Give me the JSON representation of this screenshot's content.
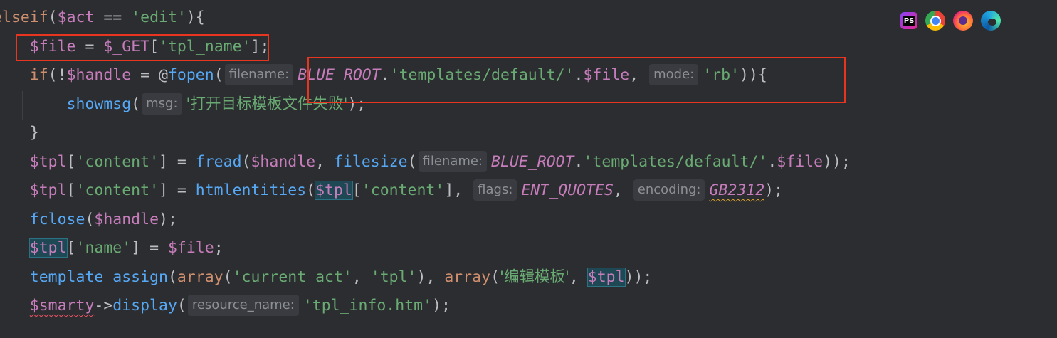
{
  "code_lines": [
    {
      "tokens": [
        {
          "t": "elseif",
          "c": "kw"
        },
        {
          "t": "(",
          "c": "op"
        },
        {
          "t": "$act",
          "c": "var"
        },
        {
          "t": " == ",
          "c": "op"
        },
        {
          "t": "'edit'",
          "c": "str"
        },
        {
          "t": "){",
          "c": "op"
        }
      ]
    },
    {
      "tokens": [
        {
          "t": "    ",
          "c": "op"
        },
        {
          "t": "$file",
          "c": "var"
        },
        {
          "t": " = ",
          "c": "op"
        },
        {
          "t": "$_GET",
          "c": "var"
        },
        {
          "t": "[",
          "c": "op"
        },
        {
          "t": "'tpl_name'",
          "c": "str"
        },
        {
          "t": "];",
          "c": "op"
        }
      ]
    },
    {
      "tokens": [
        {
          "t": "    ",
          "c": "op"
        },
        {
          "t": "if",
          "c": "kw"
        },
        {
          "t": "(!",
          "c": "op"
        },
        {
          "t": "$handle",
          "c": "var"
        },
        {
          "t": " = ",
          "c": "op"
        },
        {
          "t": "@",
          "c": "op"
        },
        {
          "t": "fopen",
          "c": "fn"
        },
        {
          "t": "(",
          "c": "op"
        },
        {
          "hint": "filename:"
        },
        {
          "t": "BLUE_ROOT",
          "c": "const"
        },
        {
          "t": ".",
          "c": "op"
        },
        {
          "t": "'templates/default/'",
          "c": "str"
        },
        {
          "t": ".",
          "c": "op"
        },
        {
          "t": "$file",
          "c": "var"
        },
        {
          "t": ", ",
          "c": "op"
        },
        {
          "hint": "mode:"
        },
        {
          "t": "'rb'",
          "c": "str"
        },
        {
          "t": ")){",
          "c": "op"
        }
      ]
    },
    {
      "tokens": [
        {
          "t": "        ",
          "c": "op"
        },
        {
          "t": "showmsg",
          "c": "fn"
        },
        {
          "t": "(",
          "c": "op"
        },
        {
          "hint": "msg:"
        },
        {
          "t": "'打开目标模板文件失败'",
          "c": "str cjk"
        },
        {
          "t": ");",
          "c": "op"
        }
      ]
    },
    {
      "tokens": [
        {
          "t": "    ",
          "c": "op"
        },
        {
          "t": "}",
          "c": "op"
        }
      ]
    },
    {
      "tokens": [
        {
          "t": "    ",
          "c": "op"
        },
        {
          "t": "$tpl",
          "c": "var"
        },
        {
          "t": "[",
          "c": "op"
        },
        {
          "t": "'content'",
          "c": "str"
        },
        {
          "t": "] = ",
          "c": "op"
        },
        {
          "t": "fread",
          "c": "fn"
        },
        {
          "t": "(",
          "c": "op"
        },
        {
          "t": "$handle",
          "c": "var"
        },
        {
          "t": ", ",
          "c": "op"
        },
        {
          "t": "filesize",
          "c": "fn"
        },
        {
          "t": "(",
          "c": "op"
        },
        {
          "hint": "filename:"
        },
        {
          "t": "BLUE_ROOT",
          "c": "const"
        },
        {
          "t": ".",
          "c": "op"
        },
        {
          "t": "'templates/default/'",
          "c": "str"
        },
        {
          "t": ".",
          "c": "op"
        },
        {
          "t": "$file",
          "c": "var"
        },
        {
          "t": "));",
          "c": "op"
        }
      ]
    },
    {
      "tokens": [
        {
          "t": "    ",
          "c": "op"
        },
        {
          "t": "$tpl",
          "c": "var"
        },
        {
          "t": "[",
          "c": "op"
        },
        {
          "t": "'content'",
          "c": "str"
        },
        {
          "t": "] = ",
          "c": "op"
        },
        {
          "t": "htmlentities",
          "c": "fn"
        },
        {
          "t": "(",
          "c": "op"
        },
        {
          "t": "$tpl",
          "c": "var hl"
        },
        {
          "t": "[",
          "c": "op"
        },
        {
          "t": "'content'",
          "c": "str"
        },
        {
          "t": "], ",
          "c": "op"
        },
        {
          "hint": "flags:"
        },
        {
          "t": "ENT_QUOTES",
          "c": "const"
        },
        {
          "t": ", ",
          "c": "op"
        },
        {
          "hint": "encoding:"
        },
        {
          "t": "GB2312",
          "c": "const squig"
        },
        {
          "t": ");",
          "c": "op"
        }
      ]
    },
    {
      "tokens": [
        {
          "t": "    ",
          "c": "op"
        },
        {
          "t": "fclose",
          "c": "fn"
        },
        {
          "t": "(",
          "c": "op"
        },
        {
          "t": "$handle",
          "c": "var"
        },
        {
          "t": ");",
          "c": "op"
        }
      ]
    },
    {
      "tokens": [
        {
          "t": "    ",
          "c": "op"
        },
        {
          "t": "$tpl",
          "c": "var hl"
        },
        {
          "t": "[",
          "c": "op"
        },
        {
          "t": "'name'",
          "c": "str"
        },
        {
          "t": "] = ",
          "c": "op"
        },
        {
          "t": "$file",
          "c": "var"
        },
        {
          "t": ";",
          "c": "op"
        }
      ]
    },
    {
      "tokens": [
        {
          "t": "    ",
          "c": "op"
        },
        {
          "t": "template_assign",
          "c": "fn"
        },
        {
          "t": "(",
          "c": "op"
        },
        {
          "t": "array",
          "c": "kw"
        },
        {
          "t": "(",
          "c": "op"
        },
        {
          "t": "'current_act'",
          "c": "str"
        },
        {
          "t": ", ",
          "c": "op"
        },
        {
          "t": "'tpl'",
          "c": "str"
        },
        {
          "t": "), ",
          "c": "op"
        },
        {
          "t": "array",
          "c": "kw"
        },
        {
          "t": "(",
          "c": "op"
        },
        {
          "t": "'编辑模板'",
          "c": "str cjk"
        },
        {
          "t": ", ",
          "c": "op"
        },
        {
          "t": "$tpl",
          "c": "var hl"
        },
        {
          "t": "));",
          "c": "op"
        }
      ]
    },
    {
      "tokens": [
        {
          "t": "    ",
          "c": "op"
        },
        {
          "t": "$smarty",
          "c": "var squig-red"
        },
        {
          "t": "->",
          "c": "op"
        },
        {
          "t": "display",
          "c": "fn"
        },
        {
          "t": "(",
          "c": "op"
        },
        {
          "hint": "resource_name:"
        },
        {
          "t": "'tpl_info.htm'",
          "c": "str"
        },
        {
          "t": ");",
          "c": "op"
        }
      ]
    }
  ],
  "browser_icons": [
    {
      "name": "phpstorm-icon",
      "label": "PS"
    },
    {
      "name": "chrome-icon",
      "label": ""
    },
    {
      "name": "firefox-icon",
      "label": ""
    },
    {
      "name": "edge-icon",
      "label": ""
    }
  ],
  "colors": {
    "background": "#2b2d30",
    "keyword": "#cf8e6d",
    "variable": "#c77dbb",
    "string": "#6aab73",
    "function": "#56a8f5",
    "annotation_box": "#e8351f"
  }
}
